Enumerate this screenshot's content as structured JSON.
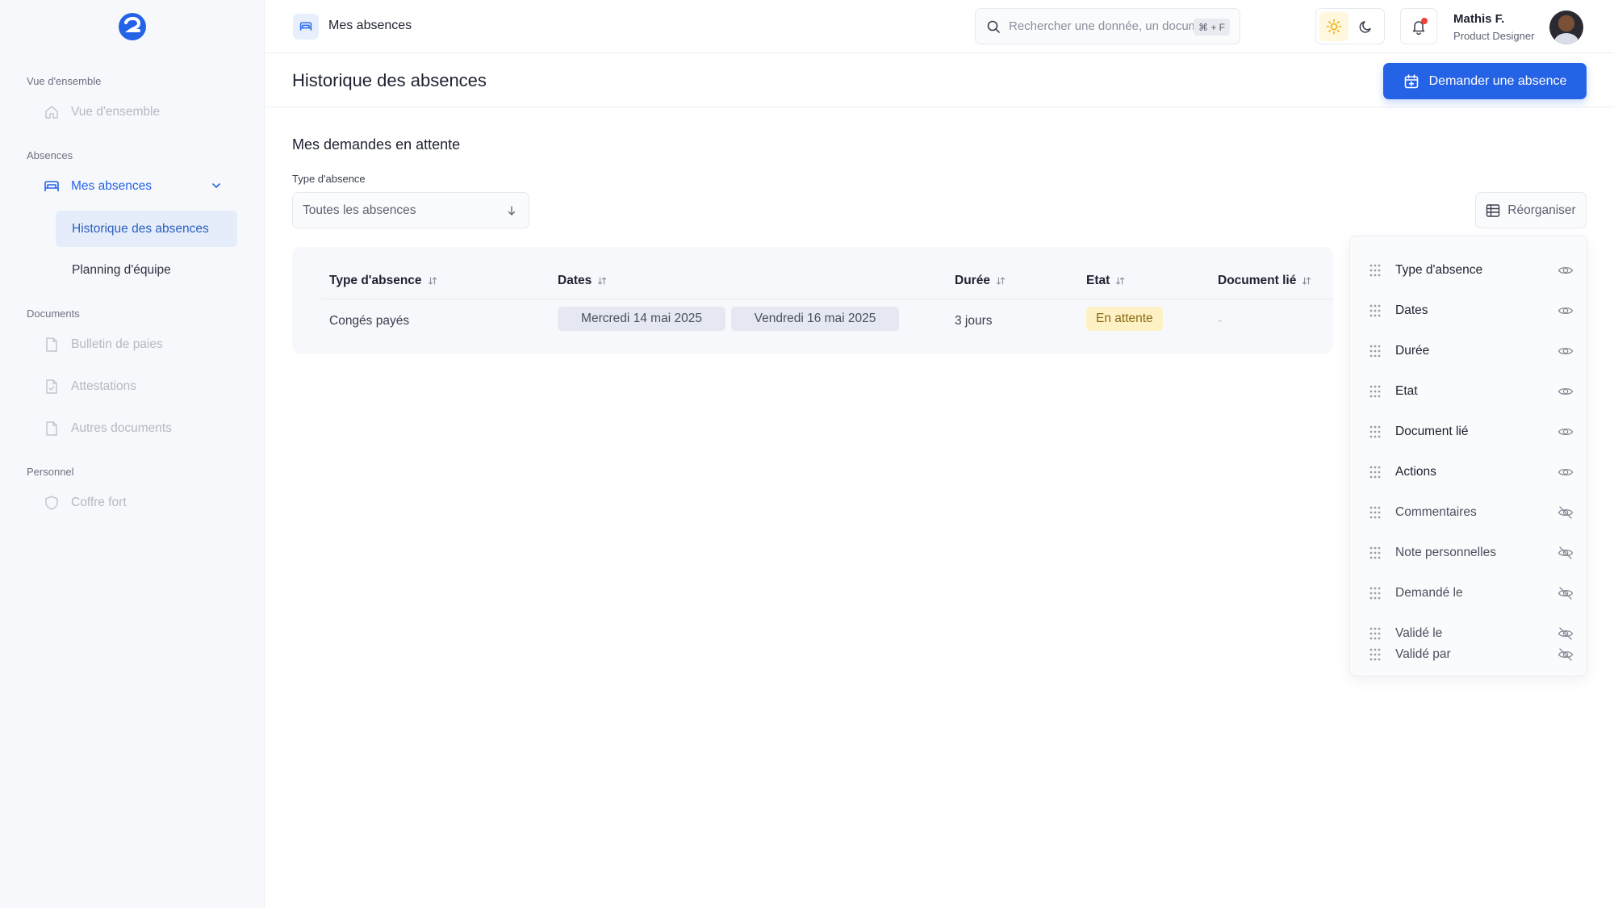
{
  "sidebar": {
    "sections": [
      {
        "title": "Vue d'ensemble",
        "items": [
          {
            "label": "Vue d'ensemble",
            "icon": "home-icon"
          }
        ]
      },
      {
        "title": "Absences",
        "items": [
          {
            "label": "Mes absences",
            "icon": "bed-icon"
          }
        ]
      },
      {
        "title": "Documents",
        "items": [
          {
            "label": "Bulletin de paies",
            "icon": "document-icon"
          },
          {
            "label": "Attestations",
            "icon": "document-check-icon"
          },
          {
            "label": "Autres documents",
            "icon": "document-icon"
          }
        ]
      },
      {
        "title": "Personnel",
        "items": [
          {
            "label": "Coffre fort",
            "icon": "shield-icon"
          }
        ]
      }
    ],
    "sub_items": [
      "Historique des absences",
      "Planning d'équipe"
    ]
  },
  "topbar": {
    "breadcrumb": "Mes absences",
    "search_placeholder": "Rechercher une donnée, un document...",
    "search_shortcut": "⌘ + F",
    "user_name": "Mathis F.",
    "user_role": "Product Designer"
  },
  "page": {
    "title": "Historique des absences",
    "primary_action": "Demander une absence",
    "section_title": "Mes demandes en attente",
    "filter_label": "Type d'absence",
    "filter_value": "Toutes les absences",
    "reorganize_label": "Réorganiser"
  },
  "table": {
    "headers": [
      "Type d'absence",
      "Dates",
      "Durée",
      "Etat",
      "Document lié"
    ],
    "rows": [
      {
        "type": "Congés payés",
        "start": "Mercredi 14 mai 2025",
        "end": "Vendredi 16 mai 2025",
        "duration": "3 jours",
        "status": "En attente",
        "document": "-"
      }
    ]
  },
  "columns_menu": {
    "visible": [
      "Type d'absence",
      "Dates",
      "Durée",
      "Etat",
      "Document lié",
      "Actions"
    ],
    "hidden": [
      "Commentaires",
      "Note personnelles",
      "Demandé le",
      "Validé le",
      "Validé par"
    ]
  },
  "colors": {
    "accent": "#2563e6",
    "status_pending_bg": "#fdf1c5",
    "status_pending_text": "#8a6a12",
    "notification": "#ef4136"
  }
}
